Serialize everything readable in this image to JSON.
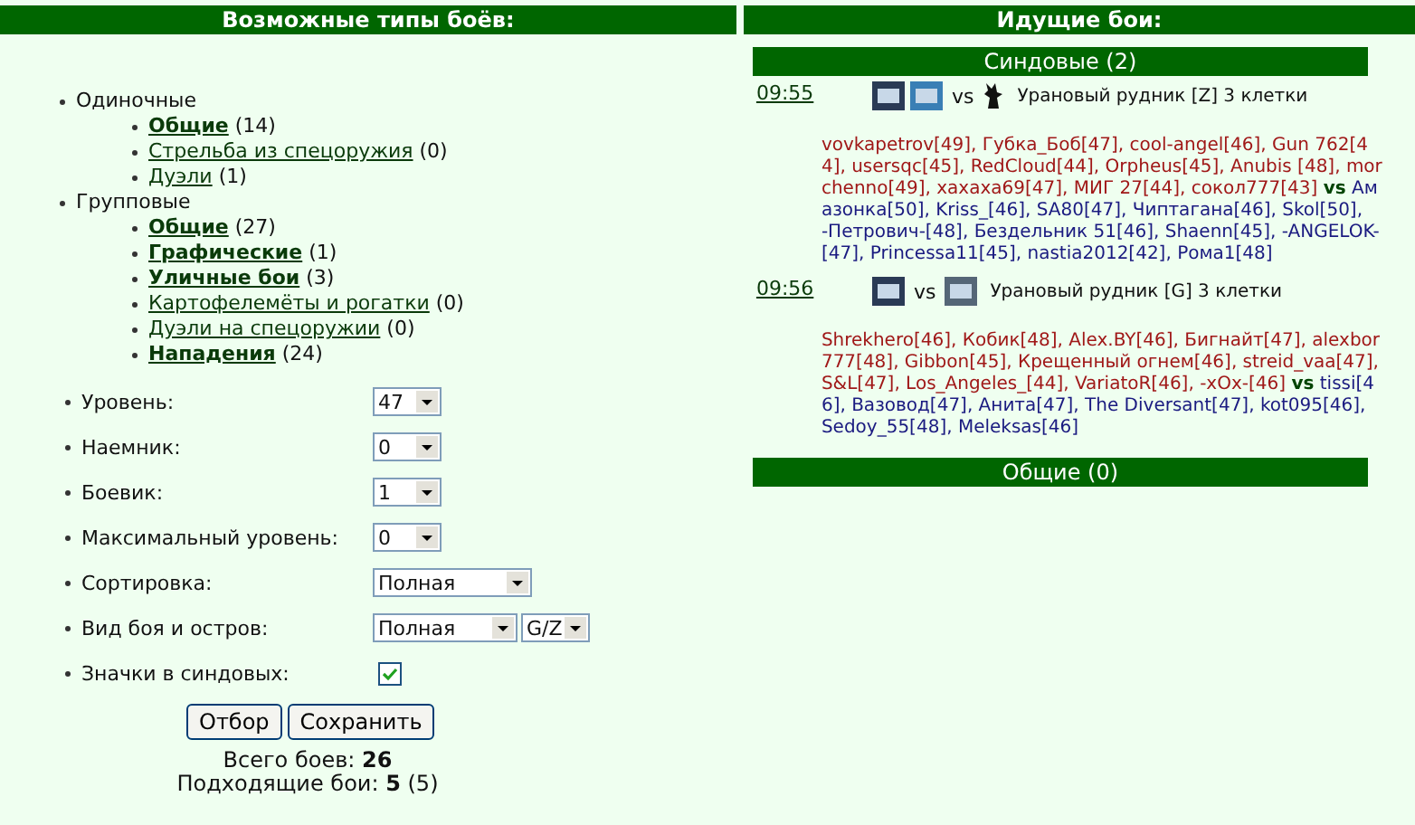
{
  "types_panel": {
    "title": "Возможные типы боёв:",
    "groups": [
      {
        "label": "Одиночные",
        "items": [
          {
            "label": "Общие",
            "count": "(14)",
            "bold": true
          },
          {
            "label": "Стрельба из спецоружия",
            "count": "(0)",
            "bold": false
          },
          {
            "label": "Дуэли",
            "count": "(1)",
            "bold": false
          }
        ]
      },
      {
        "label": "Групповые",
        "items": [
          {
            "label": "Общие",
            "count": "(27)",
            "bold": true
          },
          {
            "label": "Графические",
            "count": "(1)",
            "bold": true
          },
          {
            "label": "Уличные бои",
            "count": "(3)",
            "bold": true
          },
          {
            "label": "Картофелемёты и рогатки",
            "count": "(0)",
            "bold": false
          },
          {
            "label": "Дуэли на спецоружии",
            "count": "(0)",
            "bold": false
          },
          {
            "label": "Нападения",
            "count": "(24)",
            "bold": true
          }
        ]
      }
    ],
    "settings": [
      {
        "label": "Уровень:",
        "kind": "select",
        "selects": [
          {
            "value": "47"
          }
        ]
      },
      {
        "label": "Наемник:",
        "kind": "select",
        "selects": [
          {
            "value": "0"
          }
        ]
      },
      {
        "label": "Боевик:",
        "kind": "select",
        "selects": [
          {
            "value": "1"
          }
        ]
      },
      {
        "label": "Максимальный уровень:",
        "kind": "select",
        "selects": [
          {
            "value": "0"
          }
        ]
      },
      {
        "label": "Сортировка:",
        "kind": "select",
        "selects": [
          {
            "value": "Полная"
          }
        ]
      },
      {
        "label": "Вид боя и остров:",
        "kind": "select",
        "selects": [
          {
            "value": "Полная"
          },
          {
            "value": "G/Z"
          }
        ]
      },
      {
        "label": "Значки в синдовых:",
        "kind": "checkbox",
        "checked": true
      }
    ],
    "buttons": [
      "Отбор",
      "Сохранить"
    ],
    "totals": [
      "Всего боев: **26**",
      "Подходящие бои: **5** (5)"
    ]
  },
  "battles_panel": {
    "title": "Идущие бои:",
    "sections": [
      {
        "title": "Синдовые (2)",
        "battles": [
          {
            "time": "09:55",
            "side1_emblems": [
              {
                "kind": "clan"
              },
              {
                "kind": "clan"
              }
            ],
            "vs": "vs",
            "side2_emblems": [
              {
                "kind": "monster"
              }
            ],
            "location": "Урановый рудник [Z] 3 клетки",
            "team1": "vovkapetrov[49], Губка_Боб[47], cool-angel[46], Gun 762[44], usersqc[45], RedCloud[44], Orpheus[45], Anubis [48], morchenno[49], хахаха69[47], МИГ 27[44], сокол777[43]",
            "team_vs": "vs",
            "team2": "Амазонка[50], Kriss_[46], SA80[47], Чиптагана[46], Skol[50], -Петрович-[48], Бездельник 51[46], Shaenn[45], -ANGELOK-[47], Princessa11[45], nastia2012[42], Рома1[48]"
          },
          {
            "time": "09:56",
            "side1_emblems": [
              {
                "kind": "clan"
              }
            ],
            "vs": "vs",
            "side2_emblems": [
              {
                "kind": "clan"
              }
            ],
            "location": "Урановый рудник [G] 3 клетки",
            "team1": "Shrekhero[46], Кобик[48], Alex.BY[46], Бигнайт[47], alexbor777[48], Gibbon[45], Крещенный огнем[46], streid_vaa[47], S&L[47], Los_Angeles_[44], VariatoR[46], -хОх-[46]",
            "team_vs": "vs",
            "team2": "tissi[46], Вазовод[47], Анита[47], The Diversant[47], kot095[46], Sedoy_55[48], Meleksas[46]"
          }
        ]
      },
      {
        "title": "Общие (0)"
      }
    ]
  }
}
